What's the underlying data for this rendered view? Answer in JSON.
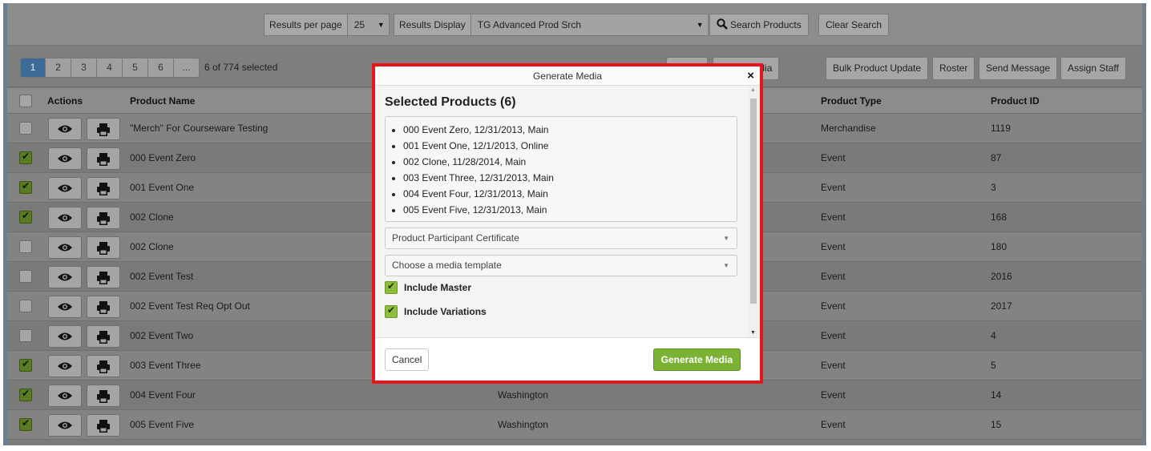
{
  "search": {
    "results_per_page_label": "Results per page",
    "results_per_page_value": "25",
    "results_display_label": "Results Display",
    "results_display_value": "TG Advanced Prod Srch",
    "search_button": "Search Products",
    "clear_button": "Clear Search"
  },
  "toolbar": {
    "pages": [
      "1",
      "2",
      "3",
      "4",
      "5",
      "6",
      "..."
    ],
    "active_page": "1",
    "selected_text": "6 of 774 selected",
    "product_media_button": "oduct Media",
    "bulk_update_button": "Bulk Product Update",
    "roster_button": "Roster",
    "send_message_button": "Send Message",
    "assign_staff_button": "Assign Staff"
  },
  "table": {
    "headers": {
      "actions": "Actions",
      "product_name": "Product Name",
      "product_type": "Product Type",
      "product_id": "Product ID"
    },
    "rows": [
      {
        "checked": false,
        "name": "\"Merch\" For Courseware Testing",
        "location": "",
        "type": "Merchandise",
        "id": "1119"
      },
      {
        "checked": true,
        "name": "000 Event Zero",
        "location": "",
        "type": "Event",
        "id": "87"
      },
      {
        "checked": true,
        "name": "001 Event One",
        "location": "",
        "type": "Event",
        "id": "3"
      },
      {
        "checked": true,
        "name": "002 Clone",
        "location": "",
        "type": "Event",
        "id": "168"
      },
      {
        "checked": false,
        "name": "002 Clone",
        "location": "",
        "type": "Event",
        "id": "180"
      },
      {
        "checked": false,
        "name": "002 Event Test",
        "location": "",
        "type": "Event",
        "id": "2016"
      },
      {
        "checked": false,
        "name": "002 Event Test Req Opt Out",
        "location": "",
        "type": "Event",
        "id": "2017"
      },
      {
        "checked": false,
        "name": "002 Event Two",
        "location": "",
        "type": "Event",
        "id": "4"
      },
      {
        "checked": true,
        "name": "003 Event Three",
        "location": "",
        "type": "Event",
        "id": "5"
      },
      {
        "checked": true,
        "name": "004 Event Four",
        "location": "Washington",
        "type": "Event",
        "id": "14"
      },
      {
        "checked": true,
        "name": "005 Event Five",
        "location": "Washington",
        "type": "Event",
        "id": "15"
      }
    ]
  },
  "modal": {
    "title": "Generate Media",
    "close_symbol": "×",
    "heading": "Selected Products (6)",
    "products": [
      "000 Event Zero, 12/31/2013, Main",
      "001 Event One, 12/1/2013, Online",
      "002 Clone, 11/28/2014, Main",
      "003 Event Three, 12/31/2013, Main",
      "004 Event Four, 12/31/2013, Main",
      "005 Event Five, 12/31/2013, Main"
    ],
    "media_type_value": "Product Participant Certificate",
    "template_placeholder": "Choose a media template",
    "include_master_label": "Include Master",
    "include_master_checked": true,
    "include_variations_label": "Include Variations",
    "include_variations_checked": true,
    "cancel_button": "Cancel",
    "generate_button": "Generate Media"
  },
  "colors": {
    "highlight_border": "#e8141b",
    "primary_button": "#7bb233",
    "active_page": "#3d6b97"
  }
}
